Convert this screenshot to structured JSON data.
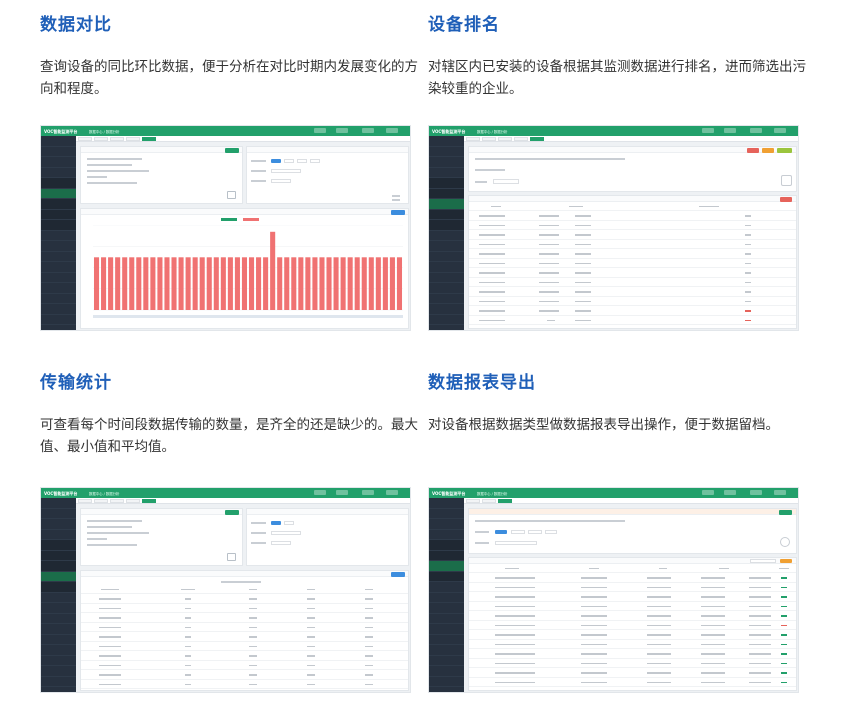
{
  "sections": [
    {
      "title": "数据对比",
      "desc": "查询设备的同比环比数据，便于分析在对比时期内发展变化的方向和程度。"
    },
    {
      "title": "设备排名",
      "desc": "对辖区内已安装的设备根据其监测数据进行排名，进而筛选出污染较重的企业。"
    },
    {
      "title": "传输统计",
      "desc": "可查看每个时间段数据传输的数量，是齐全的还是缺少的。最大值、最小值和平均值。"
    },
    {
      "title": "数据报表导出",
      "desc": "对设备根据数据类型做数据报表导出操作，便于数据留档。"
    }
  ],
  "app": {
    "brand": "VOC智能监测平台",
    "breadcrumb": "数据中心 / 数据分析"
  },
  "colors": {
    "title": "#1f5fb8",
    "header_green": "#22a06b",
    "sidebar": "#27313f",
    "bar_red": "#f07272"
  },
  "chart_data": {
    "type": "bar",
    "values": [
      62,
      62,
      62,
      62,
      62,
      62,
      62,
      62,
      62,
      62,
      62,
      62,
      62,
      62,
      62,
      62,
      62,
      62,
      62,
      62,
      62,
      62,
      62,
      62,
      62,
      92,
      62,
      62,
      62,
      62,
      62,
      62,
      62,
      62,
      62,
      62,
      62,
      62,
      62,
      62,
      62,
      62,
      62,
      62
    ],
    "ylim": [
      0,
      100
    ],
    "grid": true
  }
}
